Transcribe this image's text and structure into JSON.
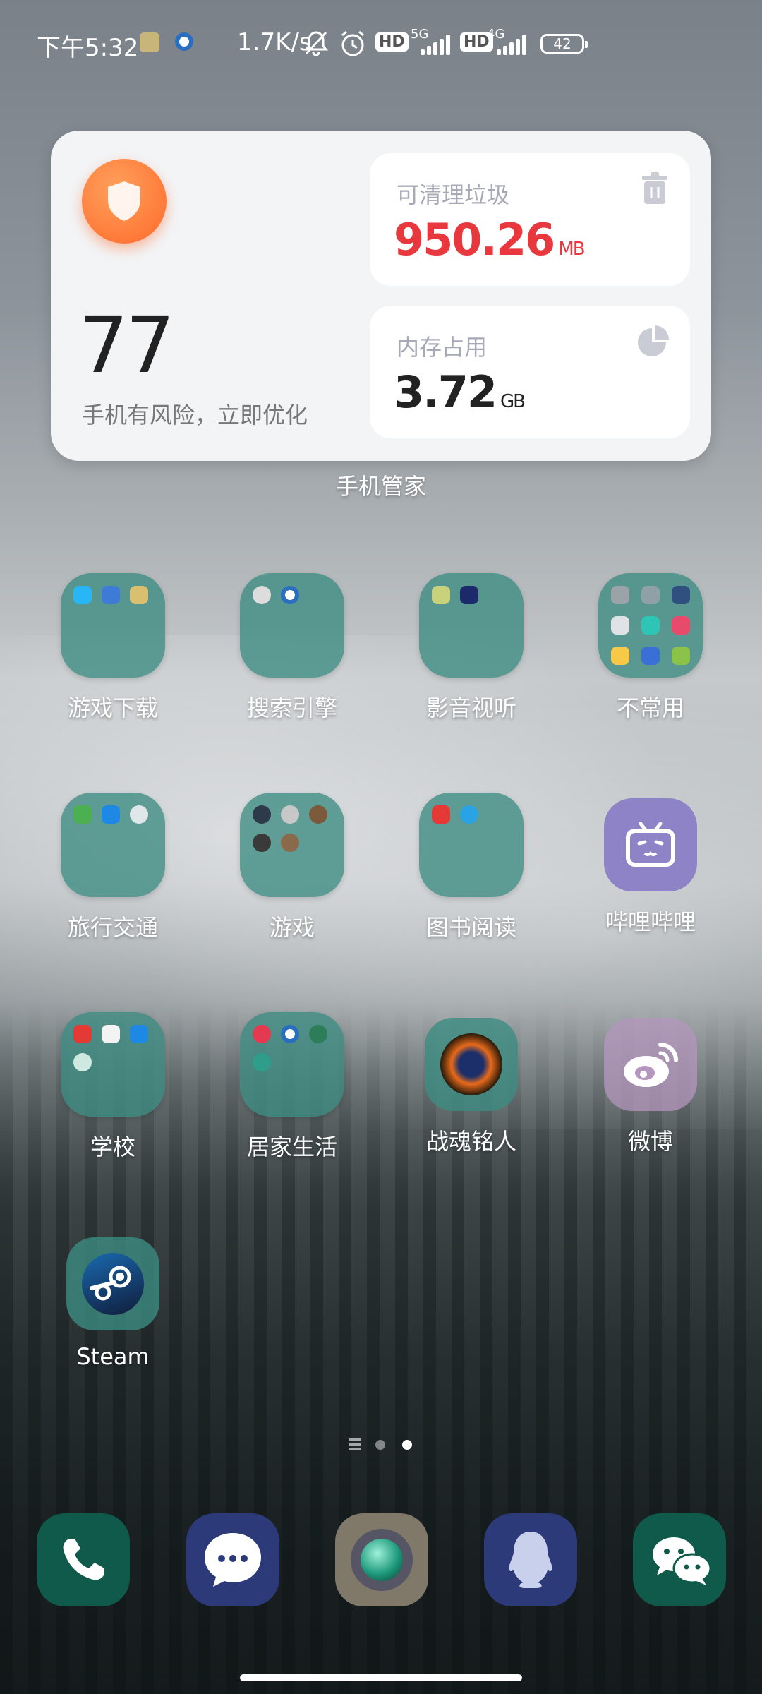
{
  "status_bar": {
    "time": "下午5:32",
    "speed": "1.7K/s",
    "hd1": "HD",
    "hd2": "HD",
    "net1": "5G",
    "net2": "4G",
    "battery": "42"
  },
  "widget": {
    "score": "77",
    "risk_text": "手机有风险，立即优化",
    "junk_title": "可清理垃圾",
    "junk_value": "950.26",
    "junk_unit": "MB",
    "memory_title": "内存占用",
    "memory_value": "3.72",
    "memory_unit": "GB",
    "label": "手机管家",
    "accent": "#ff6a2a",
    "red": "#e8373d"
  },
  "apps": [
    {
      "label": "游戏下载",
      "type": "folder"
    },
    {
      "label": "搜索引擎",
      "type": "folder"
    },
    {
      "label": "影音视听",
      "type": "folder"
    },
    {
      "label": "不常用",
      "type": "folder"
    },
    {
      "label": "旅行交通",
      "type": "folder"
    },
    {
      "label": "游戏",
      "type": "folder"
    },
    {
      "label": "图书阅读",
      "type": "folder"
    },
    {
      "label": "哔哩哔哩",
      "type": "app",
      "icon": "bilibili-icon"
    },
    {
      "label": "学校",
      "type": "folder"
    },
    {
      "label": "居家生活",
      "type": "folder"
    },
    {
      "label": "战魂铭人",
      "type": "app",
      "icon": "game-hero-icon"
    },
    {
      "label": "微博",
      "type": "app",
      "icon": "weibo-icon"
    },
    {
      "label": "Steam",
      "type": "app",
      "icon": "steam-icon"
    }
  ],
  "dock": [
    {
      "name": "phone",
      "icon": "phone-icon"
    },
    {
      "name": "messages",
      "icon": "message-icon"
    },
    {
      "name": "camera",
      "icon": "camera-icon"
    },
    {
      "name": "qq",
      "icon": "qq-icon"
    },
    {
      "name": "wechat",
      "icon": "wechat-icon"
    }
  ],
  "page_indicator": {
    "pages": 2,
    "current": 2
  }
}
